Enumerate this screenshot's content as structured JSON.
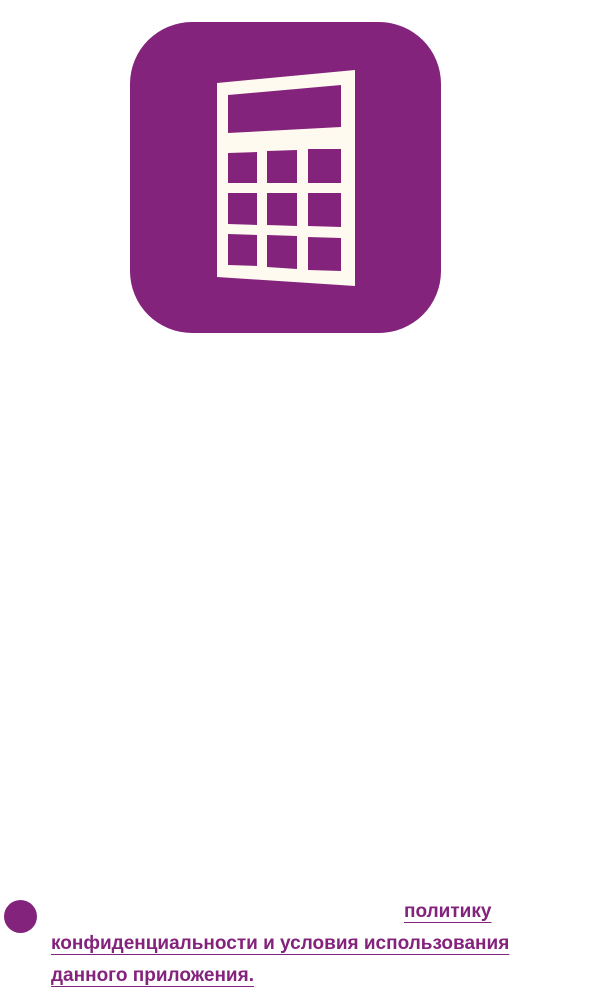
{
  "app_icon": {
    "name": "calculator-icon",
    "background": "#84237c",
    "foreground": "#fffaf0"
  },
  "consent": {
    "line1": "политику",
    "line2": "конфиденциальности и условия использования",
    "line3": "данного приложения."
  }
}
